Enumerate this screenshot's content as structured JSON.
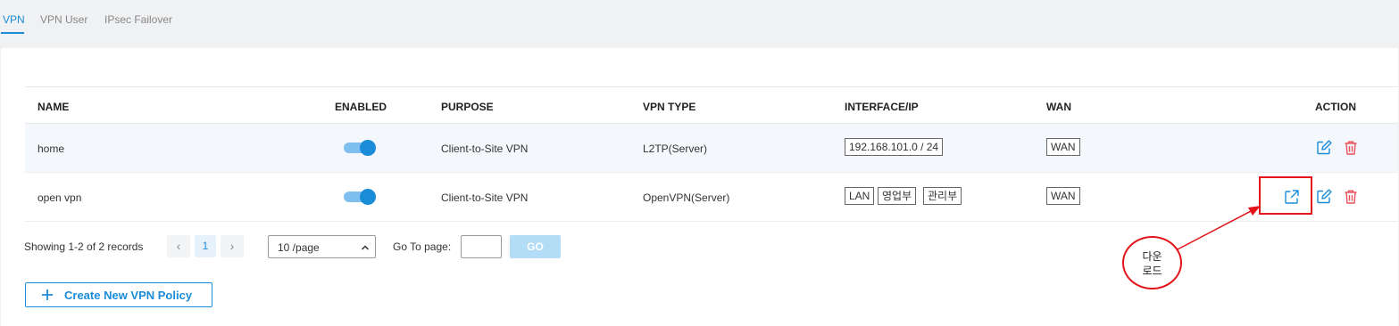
{
  "tabs": [
    {
      "label": "VPN",
      "active": true
    },
    {
      "label": "VPN User",
      "active": false
    },
    {
      "label": "IPsec Failover",
      "active": false
    }
  ],
  "table": {
    "columns": [
      "NAME",
      "ENABLED",
      "PURPOSE",
      "VPN TYPE",
      "INTERFACE/IP",
      "WAN",
      "ACTION"
    ],
    "rows": [
      {
        "name": "home",
        "enabled": true,
        "purpose": "Client-to-Site VPN",
        "vpn_type": "L2TP(Server)",
        "interfaces": [
          "192.168.101.0 / 24"
        ],
        "wan": "WAN",
        "actions": [
          "edit-icon",
          "delete-icon"
        ]
      },
      {
        "name": "open vpn",
        "enabled": true,
        "purpose": "Client-to-Site VPN",
        "vpn_type": "OpenVPN(Server)",
        "interfaces": [
          "LAN",
          "영업부",
          "관리부"
        ],
        "wan": "WAN",
        "actions": [
          "export-icon",
          "edit-icon",
          "delete-icon"
        ]
      }
    ]
  },
  "pagination": {
    "summary": "Showing 1-2 of 2 records",
    "prev": "‹",
    "next": "›",
    "current_page": "1",
    "page_size": "10 /page",
    "goto_label": "Go To page:",
    "goto_value": "",
    "go_label": "GO"
  },
  "create_button": {
    "label": "Create New VPN Policy"
  },
  "annotation": {
    "text": "다운\n로드"
  },
  "colors": {
    "accent": "#1a8cd8",
    "delete": "#e8505b",
    "annotation": "#e3141b"
  }
}
